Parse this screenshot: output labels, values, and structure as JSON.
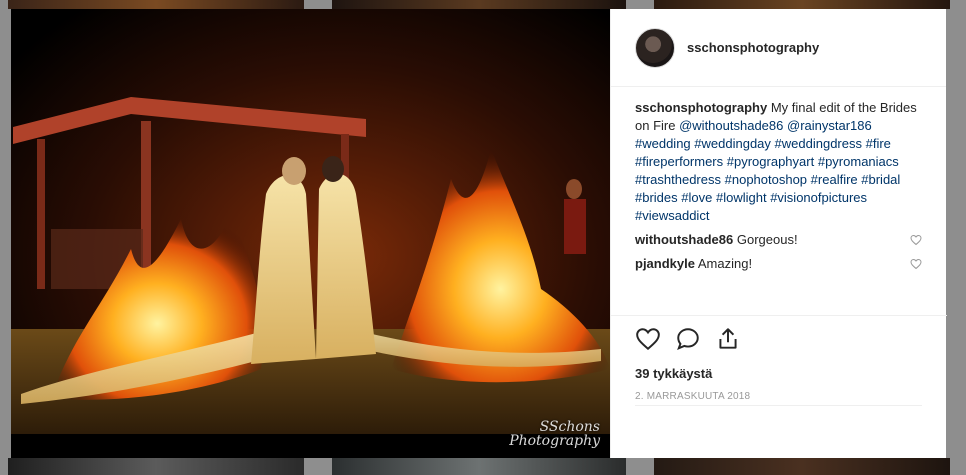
{
  "post": {
    "username": "sschonsphotography",
    "caption_user": "sschonsphotography",
    "caption_text": "My final edit of the Brides on Fire",
    "mentions": [
      "@withoutshade86",
      "@rainystar186"
    ],
    "hashtags": [
      "#wedding",
      "#weddingday",
      "#weddingdress",
      "#fire",
      "#fireperformers",
      "#pyrographyart",
      "#pyromaniacs",
      "#trashthedress",
      "#nophotoshop",
      "#realfire",
      "#bridal",
      "#brides",
      "#love",
      "#lowlight",
      "#visionofpictures",
      "#viewsaddict"
    ],
    "comments": [
      {
        "user": "withoutshade86",
        "text": "Gorgeous!"
      },
      {
        "user": "pjandkyle",
        "text": "Amazing!"
      }
    ],
    "likes": "39 tykkäystä",
    "date": "2. MARRASKUUTA 2018"
  },
  "photo": {
    "watermark_line1": "SSchons",
    "watermark_line2": "Photography"
  },
  "icons": {
    "like": "heart-icon",
    "comment": "comment-icon",
    "share": "share-icon",
    "comment_like": "heart-outline-icon"
  },
  "colors": {
    "text": "#262626",
    "link": "#003569",
    "muted": "#999999",
    "border": "#efefef",
    "backdrop": "#8e8e8e"
  }
}
